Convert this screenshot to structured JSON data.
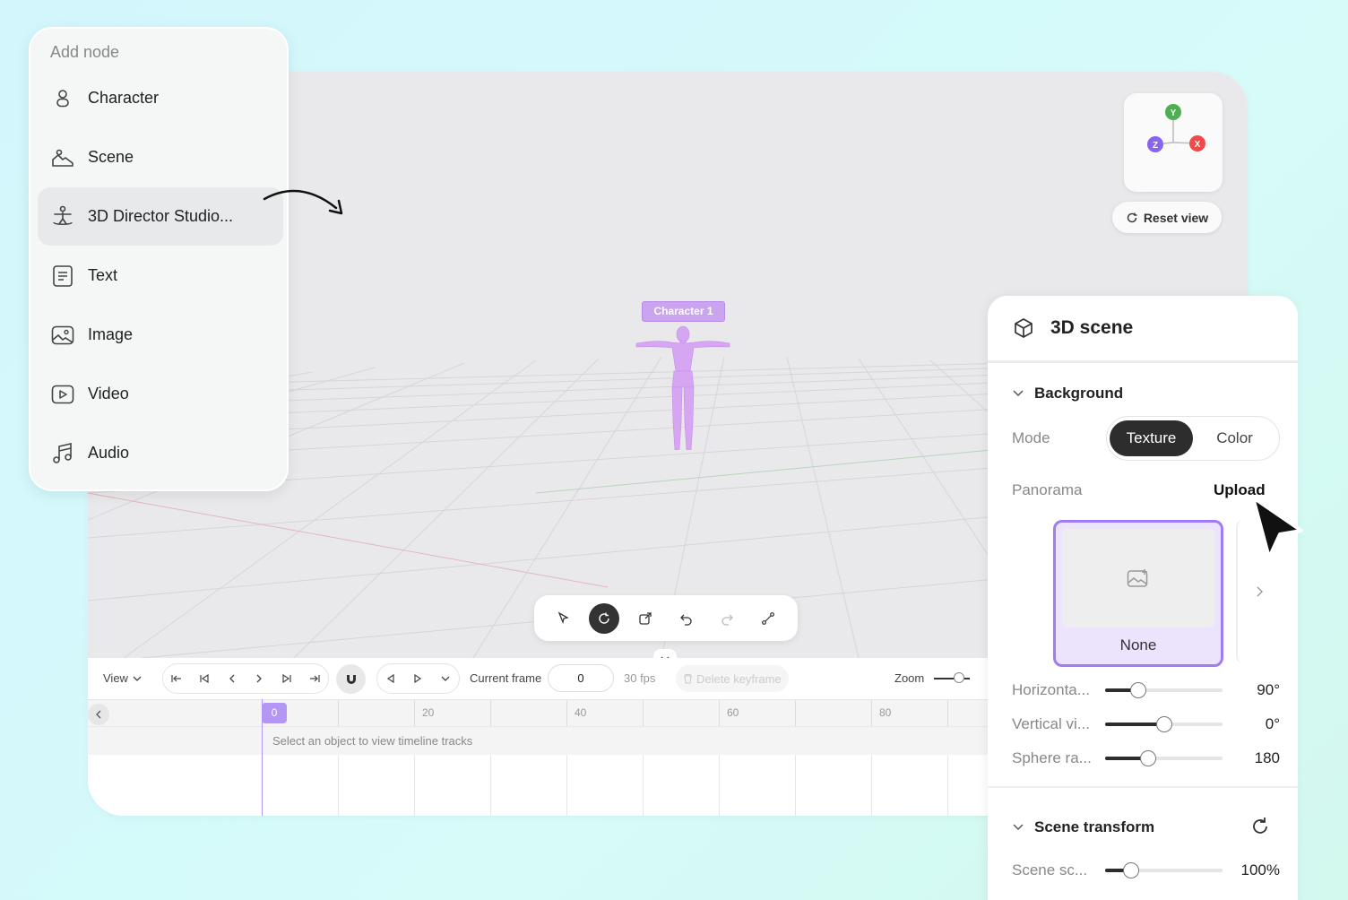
{
  "menu": {
    "title": "Add node",
    "items": [
      {
        "label": "Character",
        "icon": "person-icon"
      },
      {
        "label": "Scene",
        "icon": "landscape-icon"
      },
      {
        "label": "3D Director Studio...",
        "icon": "figure-pose-icon"
      },
      {
        "label": "Text",
        "icon": "document-icon"
      },
      {
        "label": "Image",
        "icon": "image-icon"
      },
      {
        "label": "Video",
        "icon": "video-icon"
      },
      {
        "label": "Audio",
        "icon": "music-note-icon"
      }
    ],
    "selected_index": 2
  },
  "viewport": {
    "gizmo": {
      "y": "Y",
      "x": "X",
      "z": "Z",
      "y_color": "#4caf50",
      "x_color": "#f04b4b",
      "z_color": "#8a63f0"
    },
    "reset_view": "Reset view",
    "character_label": "Character 1",
    "figure_color": "#d7a6f2"
  },
  "timeline": {
    "view_label": "View",
    "current_frame_label": "Current frame",
    "current_frame": "0",
    "fps": "30 fps",
    "delete_keyframe": "Delete keyframe",
    "zoom_label": "Zoom",
    "zoom_level": 0.6,
    "playhead": "0",
    "ticks": [
      "20",
      "40",
      "60",
      "80"
    ],
    "track_hint": "Select an object to view timeline tracks"
  },
  "scene_panel": {
    "title": "3D scene",
    "background_section": "Background",
    "mode_label": "Mode",
    "mode_options": [
      "Texture",
      "Color"
    ],
    "mode_selected": "Texture",
    "panorama_label": "Panorama",
    "upload_label": "Upload",
    "panorama_item": "None",
    "sliders": [
      {
        "label": "Horizonta...",
        "value": "90°",
        "level": 0.28
      },
      {
        "label": "Vertical vi...",
        "value": "0°",
        "level": 0.5
      },
      {
        "label": "Sphere ra...",
        "value": "180",
        "level": 0.36
      }
    ],
    "transform_section": "Scene transform",
    "scale_label": "Scene sc...",
    "scale_value": "100%",
    "scale_level": 0.22,
    "accent": "#9f7cf3"
  }
}
